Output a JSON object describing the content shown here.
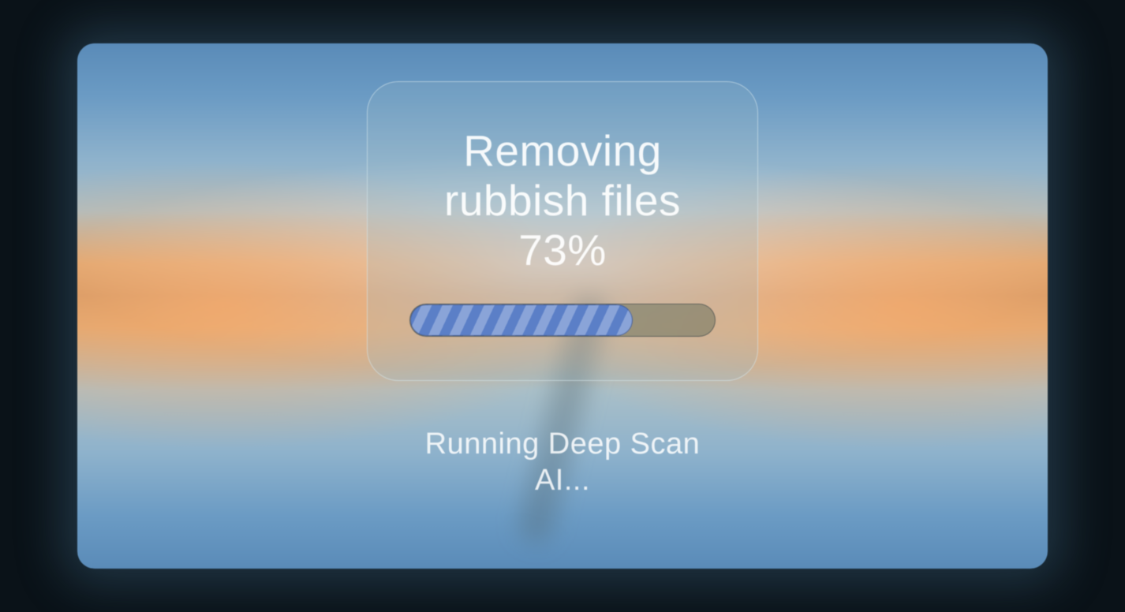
{
  "dialog": {
    "title": "Removing rubbish files",
    "progress_percent": 73,
    "percent_display": "73%"
  },
  "status": {
    "line1": "Running Deep Scan",
    "line2": "AI..."
  },
  "colors": {
    "progress_stripe_dark": "#5b7fc7",
    "progress_stripe_light": "#8aa4d8",
    "track_bg": "#6e735f"
  }
}
